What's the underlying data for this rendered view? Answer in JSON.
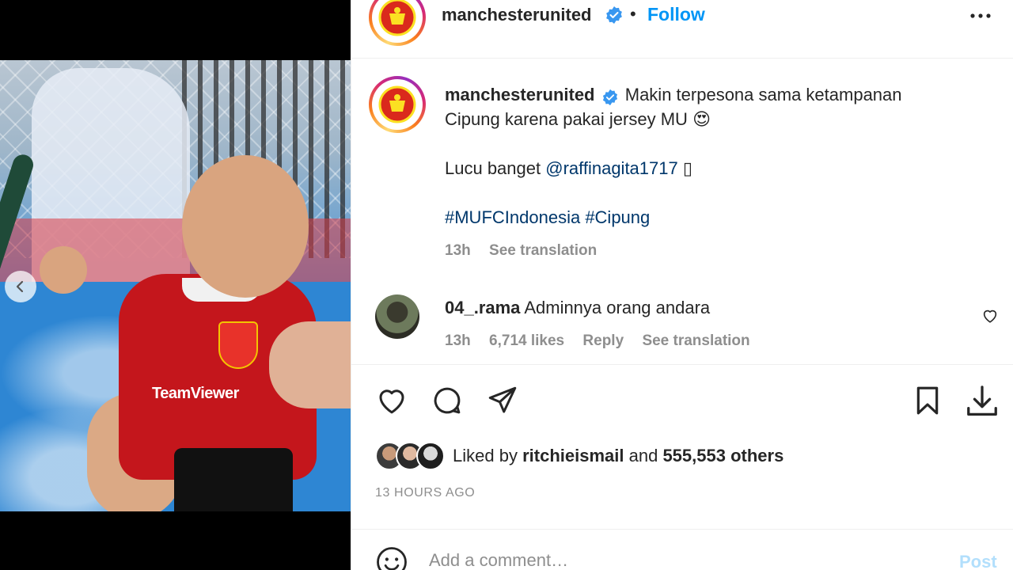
{
  "post": {
    "account": "manchesterunited",
    "follow_label": "Follow",
    "separator": "•",
    "caption": {
      "line1": "Makin terpesona sama ketampanan",
      "line2": "Cipung karena pakai jersey MU",
      "line2_emoji": "😍",
      "line3_prefix": "Lucu banget",
      "mention": "@raffinagita1717",
      "line3_suffix": "▯",
      "hashtag1": "#MUFCIndonesia",
      "hashtag2": "#Cipung",
      "time": "13h",
      "see_translation": "See translation"
    },
    "comment": {
      "username": "04_.rama",
      "text": "Adminnya orang andara",
      "time": "13h",
      "likes": "6,714 likes",
      "reply": "Reply",
      "see_translation": "See translation"
    },
    "liked_by_prefix": "Liked by",
    "liked_by_user": "ritchieismail",
    "liked_by_and": "and",
    "liked_by_others": "555,553 others",
    "timestamp": "13 HOURS AGO",
    "add_comment_placeholder": "Add a comment…",
    "post_label": "Post",
    "media_sponsor": "TeamViewer"
  },
  "colors": {
    "accent": "#0095f6",
    "verified": "#3897f0",
    "link": "#00376b",
    "muted": "#8e8e8e",
    "post_disabled": "#b2dffc"
  },
  "icons": [
    "chevron-left-icon",
    "mute-icon",
    "more-icon",
    "verified-badge-icon",
    "heart-icon",
    "comment-icon",
    "share-icon",
    "bookmark-icon",
    "download-icon",
    "emoji-icon"
  ]
}
